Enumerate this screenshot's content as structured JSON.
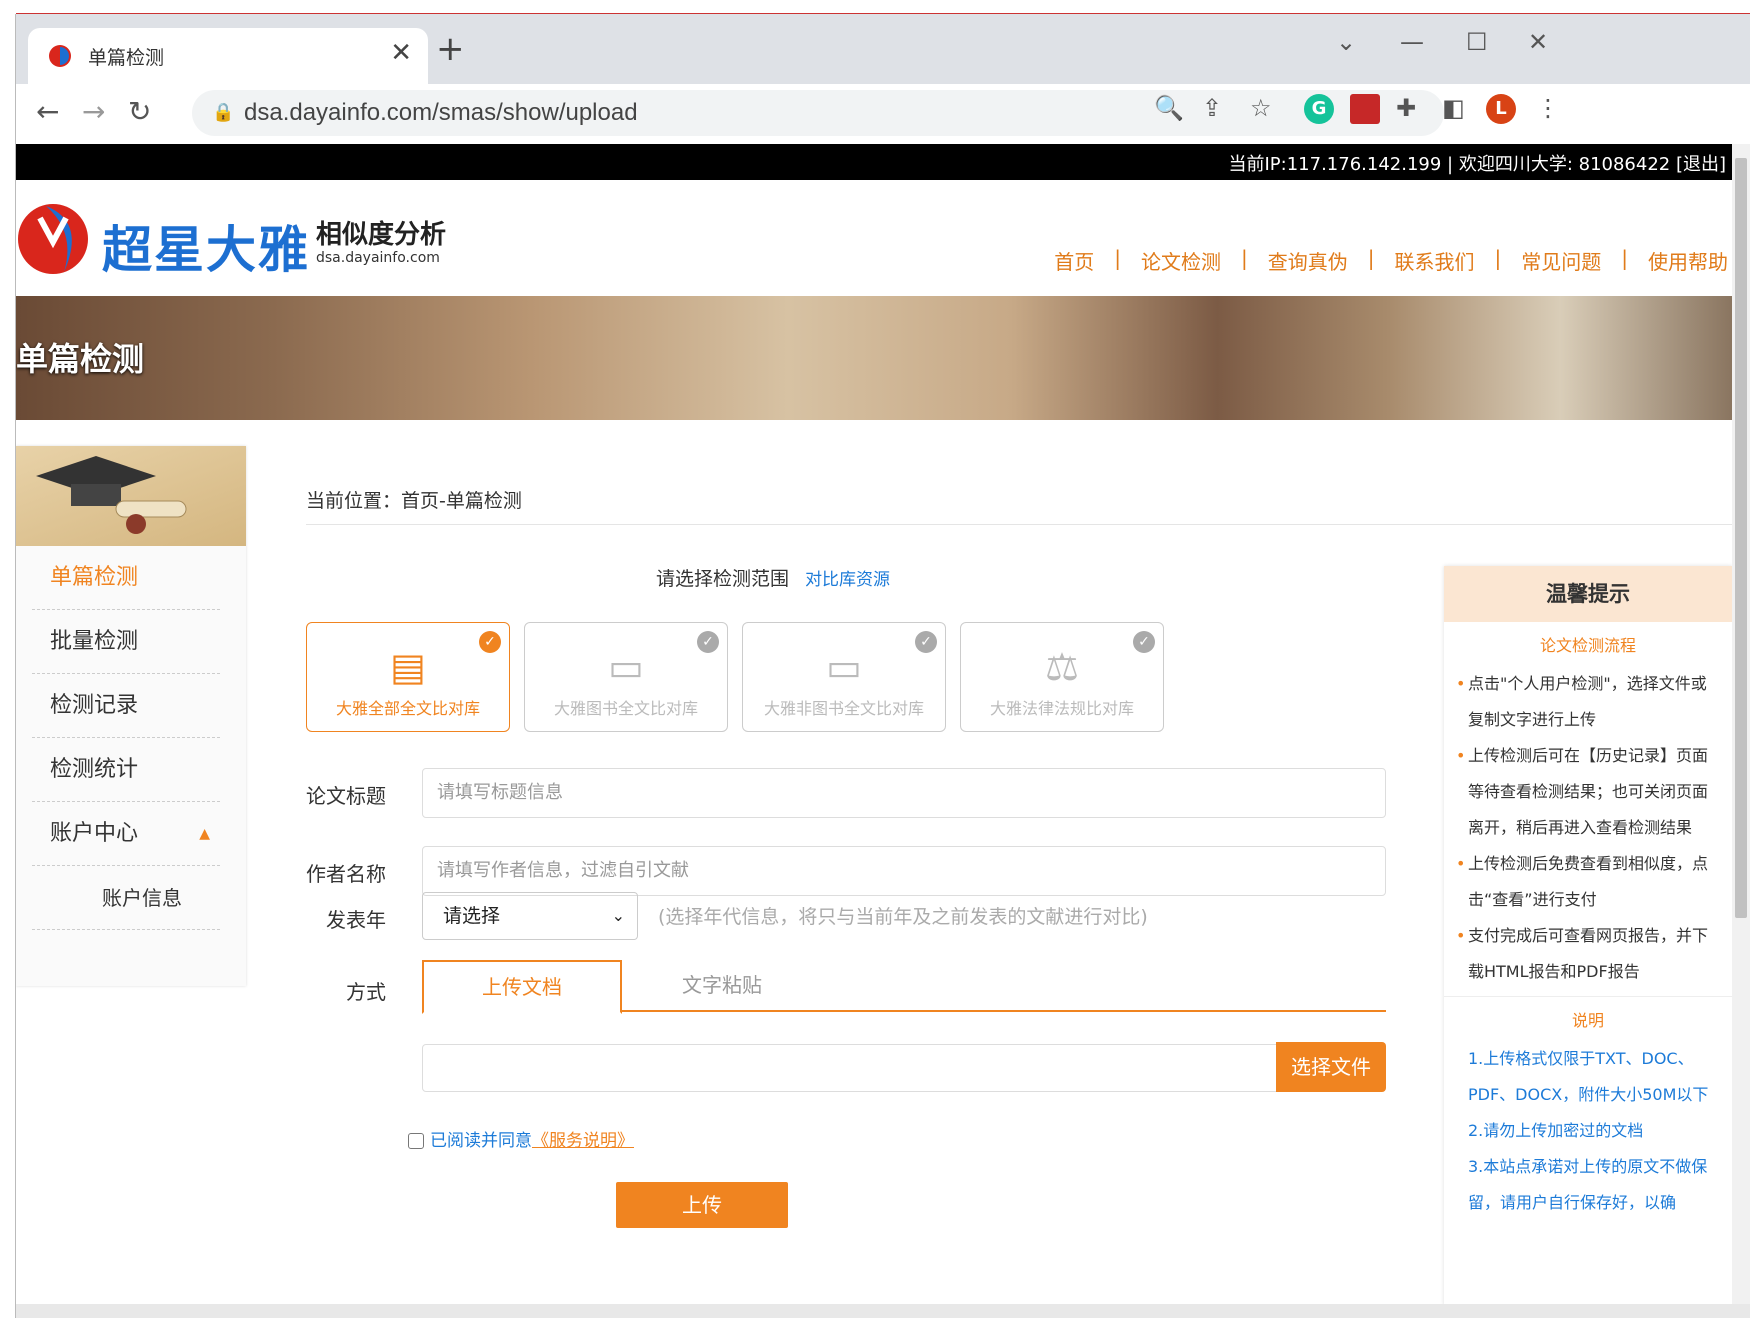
{
  "browser": {
    "tab_title": "单篇检测",
    "close_glyph": "✕",
    "new_tab_glyph": "+",
    "url": "dsa.dayainfo.com/smas/show/upload",
    "profile_initial": "L",
    "ext_g": "G"
  },
  "topbar": {
    "info": "当前IP:117.176.142.199   |   欢迎四川大学: 81086422   [退出]"
  },
  "header": {
    "brand": "超星大雅",
    "sub1": "相似度分析",
    "sub2": "dsa.dayainfo.com",
    "nav": [
      "首页",
      "论文检测",
      "查询真伪",
      "联系我们",
      "常见问题",
      "使用帮助"
    ]
  },
  "banner": {
    "title": "单篇检测"
  },
  "sidebar": {
    "items": [
      {
        "label": "单篇检测"
      },
      {
        "label": "批量检测"
      },
      {
        "label": "检测记录"
      },
      {
        "label": "检测统计"
      },
      {
        "label": "账户中心"
      },
      {
        "label": "账户信息"
      }
    ],
    "expand_glyph": "▲"
  },
  "content": {
    "crumb": "当前位置：首页-单篇检测",
    "scope_label": "请选择检测范围",
    "scope_link": "对比库资源",
    "libs": [
      {
        "label": "大雅全部全文比对库",
        "icon": "document-search-icon"
      },
      {
        "label": "大雅图书全文比对库",
        "icon": "book-icon"
      },
      {
        "label": "大雅非图书全文比对库",
        "icon": "book-icon"
      },
      {
        "label": "大雅法律法规比对库",
        "icon": "scale-icon"
      }
    ],
    "title_label": "论文标题",
    "title_placeholder": "请填写标题信息",
    "author_label": "作者名称",
    "author_placeholder": "请填写作者信息，过滤自引文献",
    "year_label": "发表年",
    "year_value": "请选择",
    "year_hint": "(选择年代信息，将只与当前年及之前发表的文献进行对比)",
    "mode_label": "方式",
    "tab_upload": "上传文档",
    "tab_paste": "文字粘贴",
    "choose_file": "选择文件",
    "agree_text": "已阅读并同意",
    "agree_link": "《服务说明》",
    "upload_btn": "上传"
  },
  "tips": {
    "title": "温馨提示",
    "flow_title": "论文检测流程",
    "flow": [
      "点击\"个人用户检测\"，选择文件或复制文字进行上传",
      "上传检测后可在【历史记录】页面等待查看检测结果；也可关闭页面离开，稍后再进入查看检测结果",
      "上传检测后免费查看到相似度，点击“查看”进行支付",
      "支付完成后可查看网页报告，并下载HTML报告和PDF报告"
    ],
    "note_title": "说明",
    "notes": [
      "1.上传格式仅限于TXT、DOC、PDF、DOCX，附件大小50M以下",
      "2.请勿上传加密过的文档",
      "3.本站点承诺对上传的原文不做保留，请用户自行保存好，以确"
    ]
  },
  "colors": {
    "accent": "#f08420",
    "brand": "#1d6fd1",
    "link": "#1d7bd8"
  }
}
